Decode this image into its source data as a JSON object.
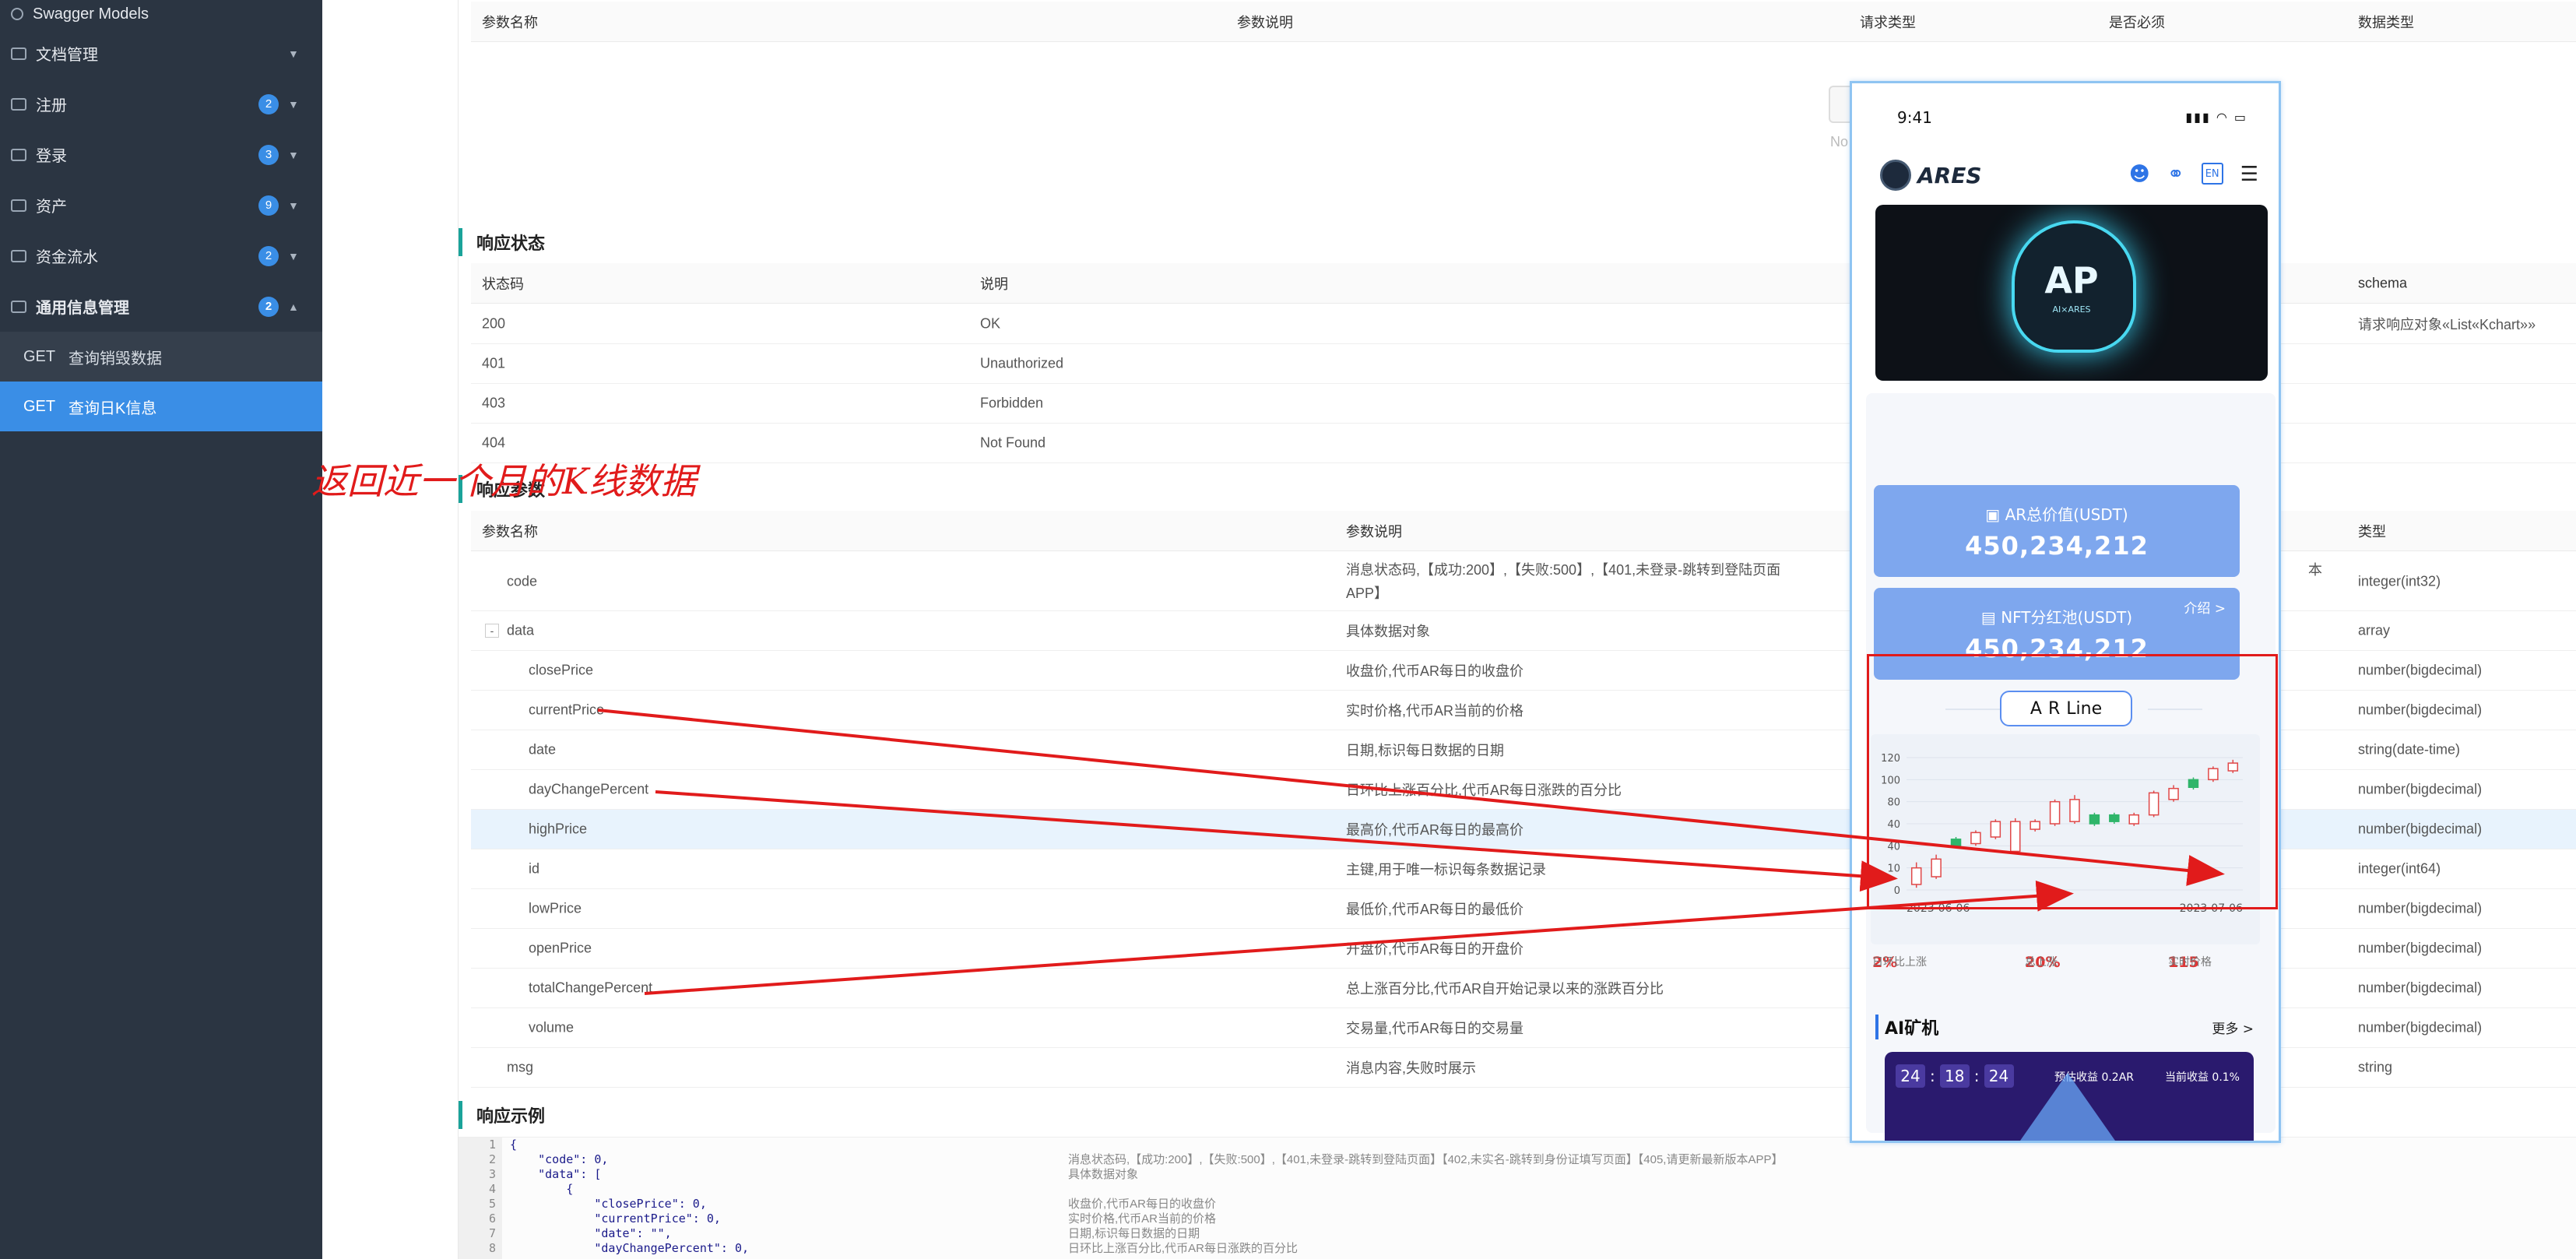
{
  "sidebar": {
    "top": "Swagger Models",
    "items": [
      {
        "label": "文档管理",
        "badge": ""
      },
      {
        "label": "注册",
        "badge": "2"
      },
      {
        "label": "登录",
        "badge": "3"
      },
      {
        "label": "资产",
        "badge": "9"
      },
      {
        "label": "资金流水",
        "badge": "2"
      },
      {
        "label": "通用信息管理",
        "badge": "2"
      }
    ],
    "sub": [
      {
        "method": "GET",
        "label": "查询销毁数据"
      },
      {
        "method": "GET",
        "label": "查询日K信息"
      }
    ]
  },
  "request_table": {
    "headers": [
      "参数名称",
      "参数说明",
      "请求类型",
      "是否必须",
      "数据类型"
    ],
    "nodata": "No Data"
  },
  "status_section": {
    "title": "响应状态",
    "headers": [
      "状态码",
      "说明",
      "schema"
    ],
    "rows": [
      {
        "code": "200",
        "desc": "OK",
        "schema": "请求响应对象«List«Kchart»»"
      },
      {
        "code": "401",
        "desc": "Unauthorized",
        "schema": ""
      },
      {
        "code": "403",
        "desc": "Forbidden",
        "schema": ""
      },
      {
        "code": "404",
        "desc": "Not Found",
        "schema": ""
      }
    ]
  },
  "annotation": "返回近一个月的K线数据",
  "response_section": {
    "title": "响应参数",
    "headers": [
      "参数名称",
      "参数说明",
      "类型"
    ],
    "rows": [
      {
        "name": "code",
        "desc": "消息状态码,【成功:200】,【失败:500】,【401,未登录-跳转到登陆页面",
        "desc2": "APP】",
        "tail": "本",
        "type": "integer(int32)"
      },
      {
        "name": "data",
        "toggle": "-",
        "desc": "具体数据对象",
        "type": "array"
      },
      {
        "name": "closePrice",
        "desc": "收盘价,代币AR每日的收盘价",
        "type": "number(bigdecimal)"
      },
      {
        "name": "currentPrice",
        "desc": "实时价格,代币AR当前的价格",
        "type": "number(bigdecimal)"
      },
      {
        "name": "date",
        "desc": "日期,标识每日数据的日期",
        "type": "string(date-time)"
      },
      {
        "name": "dayChangePercent",
        "desc": "日环比上涨百分比,代币AR每日涨跌的百分比",
        "type": "number(bigdecimal)"
      },
      {
        "name": "highPrice",
        "desc": "最高价,代币AR每日的最高价",
        "type": "number(bigdecimal)"
      },
      {
        "name": "id",
        "desc": "主键,用于唯一标识每条数据记录",
        "type": "integer(int64)"
      },
      {
        "name": "lowPrice",
        "desc": "最低价,代币AR每日的最低价",
        "type": "number(bigdecimal)"
      },
      {
        "name": "openPrice",
        "desc": "开盘价,代币AR每日的开盘价",
        "type": "number(bigdecimal)"
      },
      {
        "name": "totalChangePercent",
        "desc": "总上涨百分比,代币AR自开始记录以来的涨跌百分比",
        "type": "number(bigdecimal)"
      },
      {
        "name": "volume",
        "desc": "交易量,代币AR每日的交易量",
        "type": "number(bigdecimal)"
      },
      {
        "name": "msg",
        "desc": "消息内容,失败时展示",
        "type": "string"
      }
    ]
  },
  "example_section": {
    "title": "响应示例",
    "lines": [
      "1",
      "2",
      "3",
      "4",
      "5",
      "6",
      "7",
      "8"
    ],
    "source": [
      "{",
      "    \"code\": 0,",
      "    \"data\": [",
      "        {",
      "            \"closePrice\": 0,",
      "            \"currentPrice\": 0,",
      "            \"date\": \"\",",
      "            \"dayChangePercent\": 0,"
    ],
    "descs": [
      "",
      "消息状态码,【成功:200】,【失败:500】,【401,未登录-跳转到登陆页面】【402,未实名-跳转到身份证填写页面】【405,请更新最新版本APP】",
      "具体数据对象",
      "",
      "收盘价,代币AR每日的收盘价",
      "实时价格,代币AR当前的价格",
      "日期,标识每日数据的日期",
      "日环比上涨百分比,代币AR每日涨跌的百分比"
    ]
  },
  "phone": {
    "time": "9:41",
    "logo": "ARES",
    "lang": "EN",
    "banner_mark": "AP",
    "banner_sub": "AI×ARES",
    "card1_title": "AR总价值(USDT)",
    "card1_value": "450,234,212",
    "card2_title": "NFT分红池(USDT)",
    "card2_value": "450,234,212",
    "card2_link": "介绍 >",
    "arline": [
      "A",
      "R",
      "Line"
    ],
    "stats": {
      "day_label": "日环比上涨",
      "day_value": "2%",
      "total_label": "总上涨",
      "total_value": "20%",
      "current_label": "实时价格",
      "current_value": "115"
    },
    "ai_title": "AI矿机",
    "ai_more": "更多 >",
    "countdown": [
      "24",
      "18",
      "24"
    ],
    "est": "预估收益 0.2AR",
    "cur": "当前收益 0.1%"
  },
  "chart_data": {
    "type": "candlestick",
    "yticks": [
      0,
      20,
      40,
      60,
      80,
      100,
      120
    ],
    "ylim": [
      0,
      120
    ],
    "ytick_labels": [
      "0",
      "10",
      "40",
      "40",
      "80",
      "100",
      "120"
    ],
    "x_start": "2023-06-06",
    "x_end": "2023-07-06",
    "candles": [
      {
        "o": 20,
        "c": 5,
        "h": 25,
        "l": 2
      },
      {
        "o": 28,
        "c": 12,
        "h": 32,
        "l": 10
      },
      {
        "o": 40,
        "c": 46,
        "h": 48,
        "l": 38
      },
      {
        "o": 52,
        "c": 42,
        "h": 54,
        "l": 40
      },
      {
        "o": 62,
        "c": 48,
        "h": 64,
        "l": 46
      },
      {
        "o": 62,
        "c": 35,
        "h": 65,
        "l": 33
      },
      {
        "o": 62,
        "c": 55,
        "h": 64,
        "l": 53
      },
      {
        "o": 80,
        "c": 60,
        "h": 82,
        "l": 58
      },
      {
        "o": 82,
        "c": 62,
        "h": 86,
        "l": 60
      },
      {
        "o": 60,
        "c": 68,
        "h": 70,
        "l": 58
      },
      {
        "o": 62,
        "c": 68,
        "h": 70,
        "l": 60
      },
      {
        "o": 68,
        "c": 60,
        "h": 70,
        "l": 58
      },
      {
        "o": 88,
        "c": 68,
        "h": 90,
        "l": 66
      },
      {
        "o": 92,
        "c": 82,
        "h": 95,
        "l": 80
      },
      {
        "o": 93,
        "c": 100,
        "h": 102,
        "l": 91
      },
      {
        "o": 110,
        "c": 100,
        "h": 112,
        "l": 98
      },
      {
        "o": 115,
        "c": 108,
        "h": 118,
        "l": 106
      }
    ]
  }
}
